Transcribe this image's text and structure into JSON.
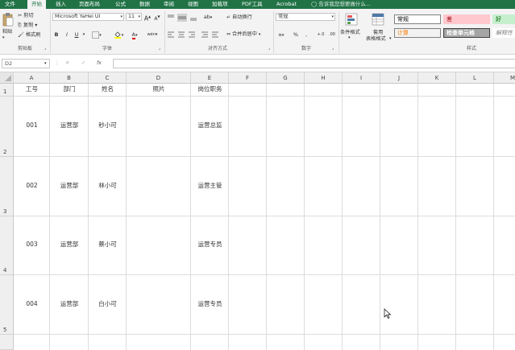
{
  "tabs": [
    "文件",
    "开始",
    "插入",
    "页面布局",
    "公式",
    "数据",
    "审阅",
    "视图",
    "加载项",
    "PDF工具",
    "Acrobat"
  ],
  "active_tab": "开始",
  "tell_me": "告诉我您想要做什么...",
  "clipboard": {
    "paste": "粘贴",
    "cut": "剪切",
    "copy": "复制",
    "format_painter": "格式刷",
    "label": "剪贴板"
  },
  "font": {
    "name": "Microsoft YaHei UI",
    "size": "11",
    "grow": "A",
    "shrink": "A",
    "bold": "B",
    "italic": "I",
    "underline": "U",
    "color_a": "A",
    "wen": "wén",
    "label": "字体"
  },
  "alignment": {
    "wrap": "自动换行",
    "merge": "合并后居中",
    "label": "对齐方式"
  },
  "number": {
    "format": "常规",
    "percent": "%",
    "comma": ",",
    "inc": "+.0",
    "dec": ".00",
    "label": "数字"
  },
  "styles_group": {
    "cond_format": "条件格式",
    "table_format_1": "套用",
    "table_format_2": "表格格式",
    "label": "样式"
  },
  "styles": [
    {
      "name": "常规",
      "bg": "#ffffff",
      "color": "#000000",
      "border": "#7f7f7f"
    },
    {
      "name": "差",
      "bg": "#ffc7ce",
      "color": "#9c0006",
      "border": "#ffc7ce"
    },
    {
      "name": "好",
      "bg": "#c6efce",
      "color": "#006100",
      "border": "#c6efce"
    },
    {
      "name": "计算",
      "bg": "#f2f2f2",
      "color": "#fa7d00",
      "border": "#7f7f7f"
    },
    {
      "name": "检查单元格",
      "bg": "#a5a5a5",
      "color": "#ffffff",
      "border": "#3f3f3f"
    },
    {
      "name": "解释性",
      "bg": "#ffffff",
      "color": "#7f7f7f",
      "border": "#ffffff"
    }
  ],
  "name_box": "D2",
  "fx": "fx",
  "columns": [
    "A",
    "B",
    "C",
    "D",
    "E",
    "F",
    "G",
    "H",
    "I",
    "J",
    "K",
    "L",
    "M"
  ],
  "rows": [
    {
      "num": "1",
      "cells": [
        "工号",
        "部门",
        "姓名",
        "照片",
        "岗位职务"
      ]
    },
    {
      "num": "2",
      "cells": [
        "001",
        "运营部",
        "秒小可",
        "",
        "运营总监"
      ]
    },
    {
      "num": "3",
      "cells": [
        "002",
        "运营部",
        "林小可",
        "",
        "运营主管"
      ]
    },
    {
      "num": "4",
      "cells": [
        "003",
        "运营部",
        "蔡小可",
        "",
        "运营专员"
      ]
    },
    {
      "num": "5",
      "cells": [
        "004",
        "运营部",
        "白小可",
        "",
        "运营专员"
      ]
    }
  ],
  "colors": {
    "brand": "#217346",
    "header_bg": "#efefef",
    "grid_line": "#dcdcdc"
  }
}
